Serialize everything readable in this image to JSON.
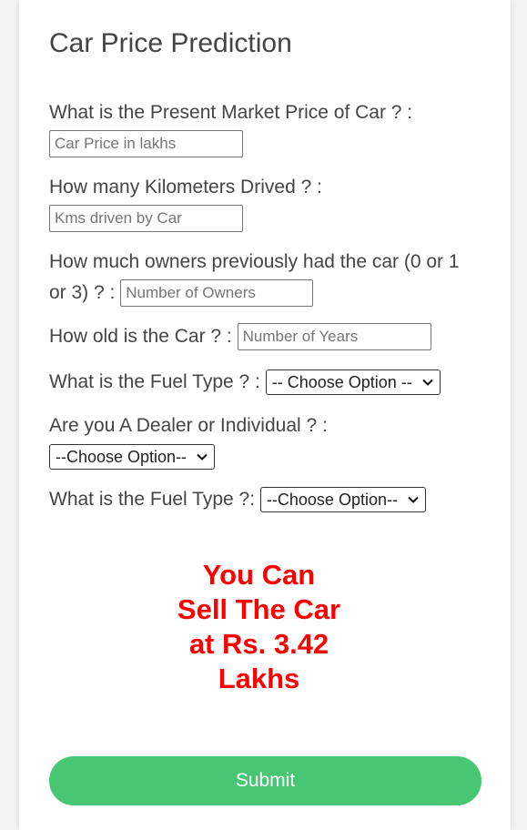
{
  "page": {
    "title": "Car Price Prediction"
  },
  "form": {
    "present_price": {
      "label": "What is the Present Market Price of Car ? :",
      "placeholder": "Car Price in lakhs"
    },
    "kms_driven": {
      "label": "How many Kilometers Drived ? :",
      "placeholder": "Kms driven by Car"
    },
    "owners": {
      "label": "How much owners previously had the car (0 or 1 or 3) ? :",
      "placeholder": "Number of Owners"
    },
    "age": {
      "label": "How old is the Car ? :",
      "placeholder": "Number of Years"
    },
    "fuel_type": {
      "label": "What is the Fuel Type ? :",
      "selected": "-- Choose Option --"
    },
    "seller_type": {
      "label": "Are you A Dealer or Individual ? :",
      "selected": "--Choose Option--"
    },
    "transmission": {
      "label": "What is the Fuel Type ?:",
      "selected": "--Choose Option--"
    }
  },
  "result": {
    "text": "You Can Sell The Car at Rs. 3.42 Lakhs"
  },
  "submit": {
    "label": "Submit"
  },
  "colors": {
    "accent": "#47c774",
    "result": "#ff0000",
    "text": "#444444"
  }
}
